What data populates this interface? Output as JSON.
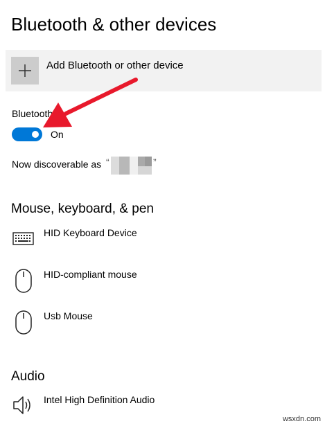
{
  "page": {
    "title": "Bluetooth & other devices"
  },
  "add_device": {
    "label": "Add Bluetooth or other device",
    "icon": "plus-icon"
  },
  "bluetooth": {
    "label": "Bluetooth",
    "toggle_state": "On",
    "toggle_on": true,
    "accent_color": "#0078d7",
    "discoverable_prefix": "Now discoverable as",
    "open_quote": "“",
    "close_quote": "”"
  },
  "mouse_keyboard_pen": {
    "heading": "Mouse, keyboard, & pen",
    "devices": [
      {
        "name": "HID Keyboard Device",
        "icon": "keyboard-icon"
      },
      {
        "name": "HID-compliant mouse",
        "icon": "mouse-icon"
      },
      {
        "name": "Usb Mouse",
        "icon": "mouse-icon"
      }
    ]
  },
  "audio": {
    "heading": "Audio",
    "devices": [
      {
        "name": "Intel High Definition Audio",
        "icon": "speaker-icon"
      }
    ]
  },
  "annotation": {
    "arrow_color": "#e8192c"
  },
  "watermark": "wsxdn.com"
}
